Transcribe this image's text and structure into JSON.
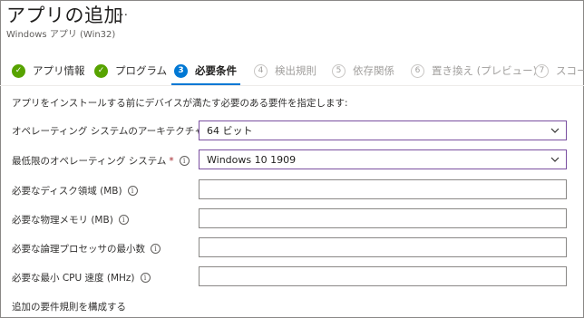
{
  "header": {
    "title": "アプリの追加",
    "more": "…",
    "subtitle": "Windows アプリ (Win32)"
  },
  "steps": [
    {
      "num": "",
      "label": "アプリ情報",
      "state": "done"
    },
    {
      "num": "",
      "label": "プログラム",
      "state": "done"
    },
    {
      "num": "3",
      "label": "必要条件",
      "state": "active"
    },
    {
      "num": "4",
      "label": "検出規則",
      "state": "pending"
    },
    {
      "num": "5",
      "label": "依存関係",
      "state": "pending"
    },
    {
      "num": "6",
      "label": "置き換え (プレビュー)",
      "state": "pending"
    },
    {
      "num": "7",
      "label": "スコープ",
      "state": "pending"
    }
  ],
  "form": {
    "description": "アプリをインストールする前にデバイスが満たす必要のある要件を指定します:",
    "architecture": {
      "label": "オペレーティング システムのアーキテクチャ",
      "required": "*",
      "value": "64 ビット"
    },
    "min_os": {
      "label": "最低限のオペレーティング システム",
      "required": "*",
      "value": "Windows 10 1909"
    },
    "disk_space": {
      "label": "必要なディスク領域 (MB)",
      "value": ""
    },
    "memory": {
      "label": "必要な物理メモリ (MB)",
      "value": ""
    },
    "processors": {
      "label": "必要な論理プロセッサの最小数",
      "value": ""
    },
    "cpu_speed": {
      "label": "必要な最小 CPU 速度 (MHz)",
      "value": ""
    },
    "additional_rules": "追加の要件規則を構成する"
  },
  "colors": {
    "accent": "#0078d4",
    "done": "#57a300",
    "required": "#a4262c",
    "select_border": "#7a4fa0"
  }
}
